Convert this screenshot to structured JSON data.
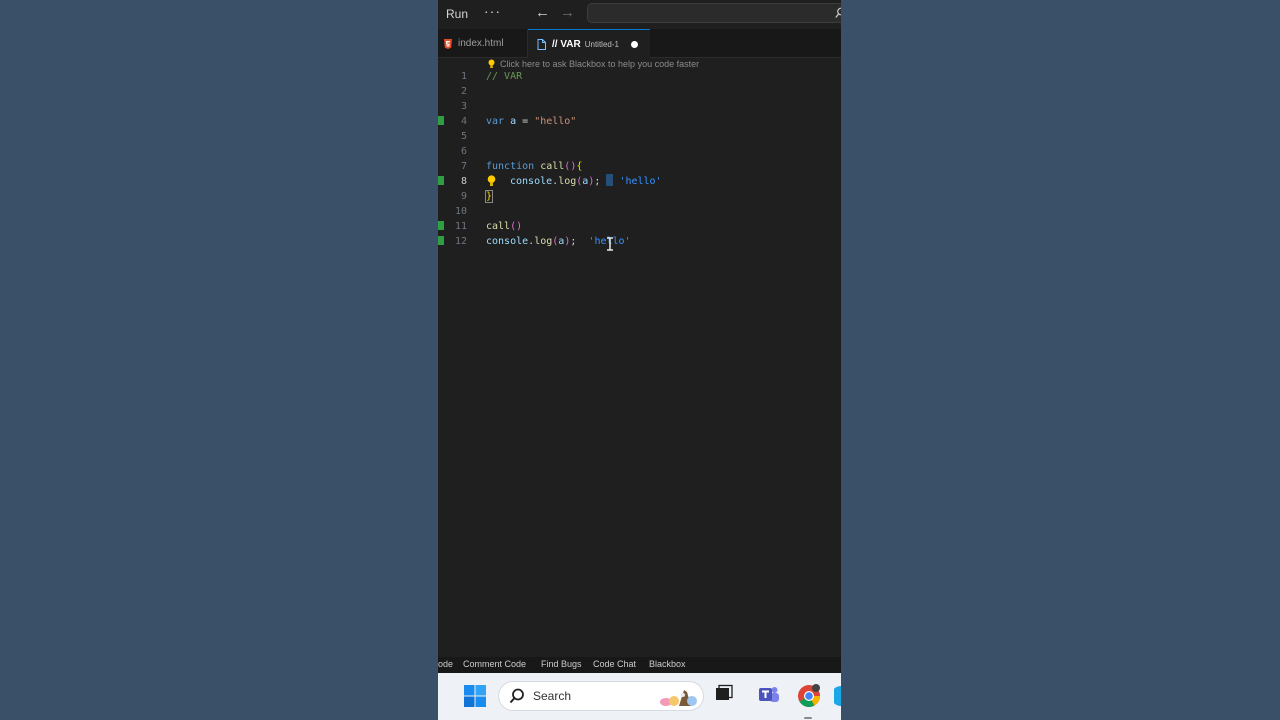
{
  "titlebar": {
    "menu_run": "Run",
    "menu_more": "···",
    "back_icon": "←",
    "forward_icon": "→"
  },
  "tabs": [
    {
      "label": "index.html",
      "icon": "html5-icon"
    },
    {
      "label": "// VAR",
      "description": "Untitled-1",
      "icon": "file-icon",
      "dirty": true
    }
  ],
  "editor": {
    "hint": "Click here to ask Blackbox to help you code faster",
    "active_line": 8,
    "line_numbers": [
      "1",
      "2",
      "3",
      "4",
      "5",
      "6",
      "7",
      "8",
      "9",
      "10",
      "11",
      "12"
    ],
    "lines": {
      "l1": {
        "comment": "// VAR"
      },
      "l4": {
        "keyword": "var",
        "name": "a",
        "op": " = ",
        "string": "\"hello\""
      },
      "l7": {
        "keyword": "function",
        "name": "call",
        "parens": "()",
        "brace": "{"
      },
      "l8": {
        "object": "console",
        "dot": ".",
        "method": "log",
        "paren_open": "(",
        "arg": "a",
        "paren_close": ")",
        "semi": ";",
        "result": "'hello'"
      },
      "l9": {
        "brace": "}"
      },
      "l11": {
        "name": "call",
        "parens": "()"
      },
      "l12": {
        "object": "console",
        "dot": ".",
        "method": "log",
        "paren_open": "(",
        "arg": "a",
        "paren_close": ")",
        "semi": ";",
        "result": "'hello'"
      }
    }
  },
  "blackbox_bar": {
    "items": [
      "ode",
      "Comment Code",
      "Find Bugs",
      "Code Chat",
      "Blackbox"
    ]
  },
  "taskbar": {
    "search_label": "Search"
  },
  "colors": {
    "accent": "#0078d4",
    "gutter_modified": "#2ea043",
    "comment": "#6a9955",
    "keyword": "#569cd6",
    "string": "#ce9178",
    "function": "#dcdcaa"
  }
}
